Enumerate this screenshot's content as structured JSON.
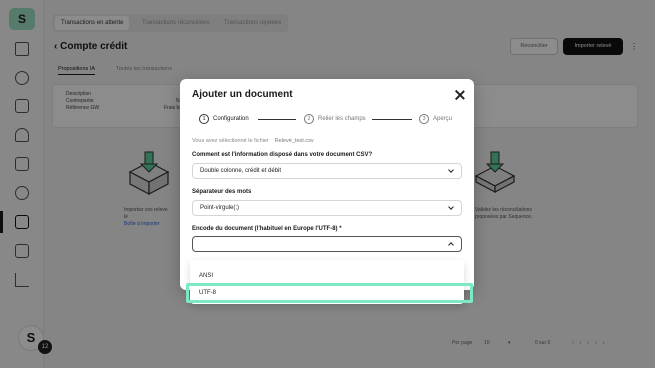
{
  "app": {
    "logo": "S",
    "avatar_letter": "S",
    "avatar_badge": "12",
    "top_tabs": [
      "Transactions en attente",
      "Transactions réconciliées",
      "Transactions rejetées"
    ],
    "page_title": "Compte crédit",
    "sub_tabs": [
      "Propositions IA",
      "Toutes les transactions"
    ],
    "reconcile_button": "Réconcilier",
    "import_button": "Importer relevé",
    "card_lines": [
      "Description",
      "Contrepartie",
      "Référence GW"
    ],
    "card_right": [
      "N",
      "Frais ba"
    ],
    "left_text": [
      "Importez vos releve",
      "le"
    ],
    "left_link": "Boîte à importer",
    "right_text": [
      "Validez les réconciliations",
      "proposées par Sequence."
    ],
    "pager_label": "Per page",
    "pager_value": "10",
    "pager_count": "0 sur 0"
  },
  "modal": {
    "title": "Ajouter un document",
    "steps": [
      {
        "number": "1",
        "label": "Configuration"
      },
      {
        "number": "2",
        "label": "Relier les champs"
      },
      {
        "number": "3",
        "label": "Aperçu"
      }
    ],
    "file_label": "Vous avez sélectionné le fichier",
    "file_name": "Relevé_test.csv",
    "fields": [
      {
        "label": "Comment est l'information disposé dans votre document CSV?",
        "value": "Double colonne, crédit et débit"
      },
      {
        "label": "Séparateur des mots",
        "value": "Point-virgule(;)"
      },
      {
        "label": "Encode du document (l'habituel en Europe l'UTF-8) *",
        "value": ""
      }
    ],
    "encoding_options": [
      "ANSI",
      "UTF-8"
    ]
  },
  "colors": {
    "highlight": "#7de8c4",
    "accent_logo": "#9fe0c4"
  }
}
